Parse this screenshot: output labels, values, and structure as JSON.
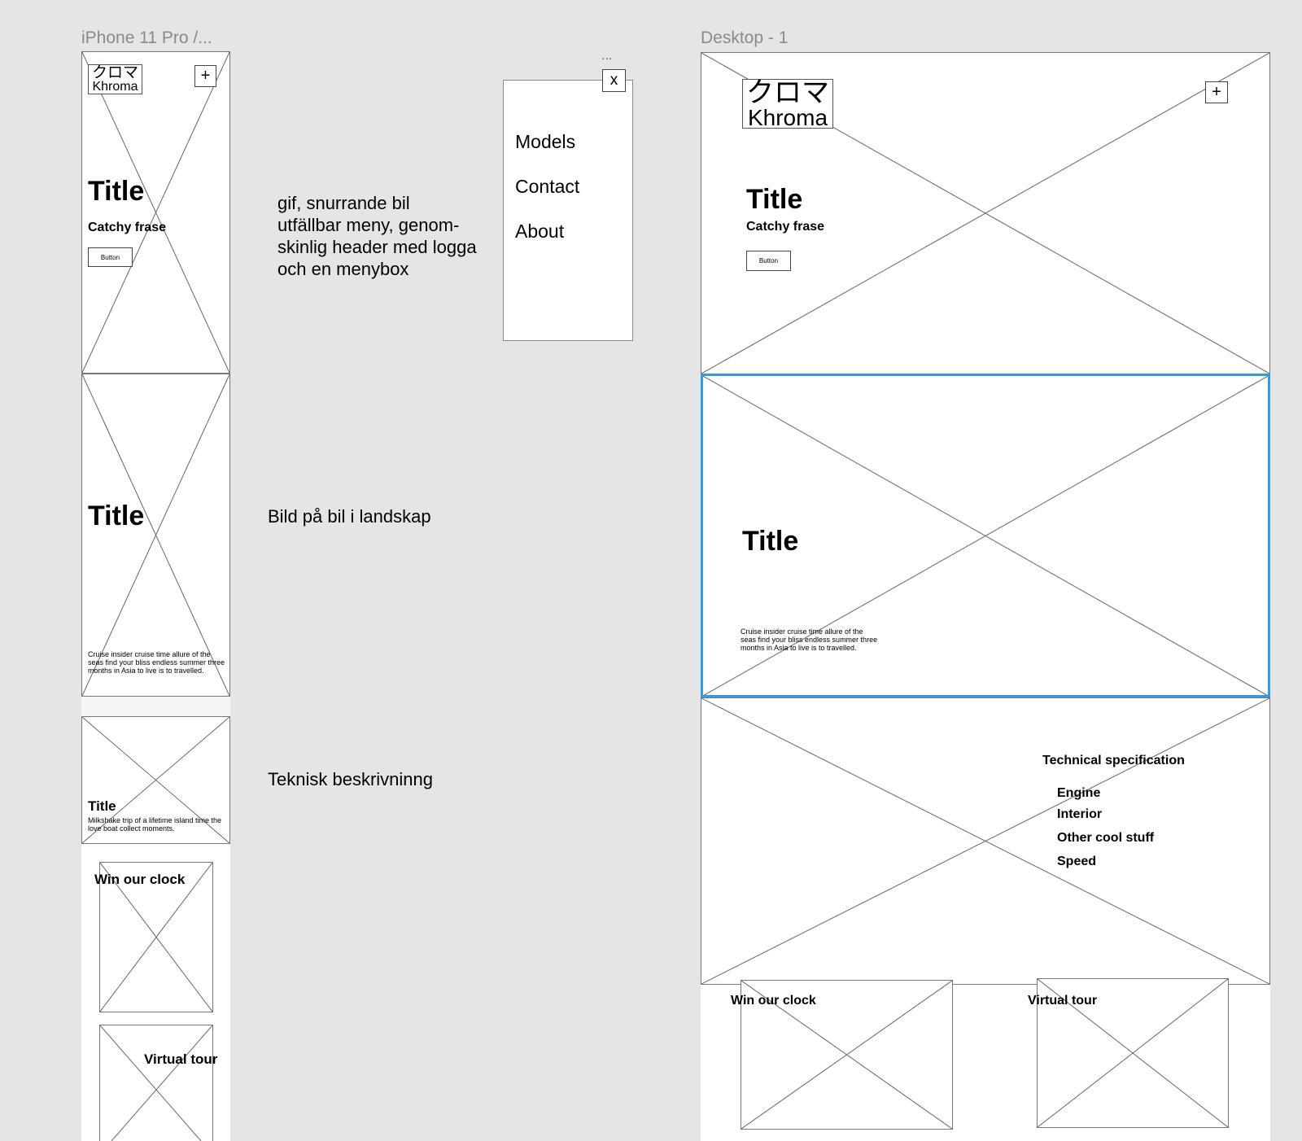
{
  "frames": {
    "iphone_label": "iPhone 11 Pro /...",
    "desktop_label": "Desktop - 1"
  },
  "logo": {
    "japanese": "クロマ",
    "latin": "Khroma"
  },
  "header": {
    "plus": "+"
  },
  "hero": {
    "title": "Title",
    "tagline": "Catchy frase",
    "button": "Button"
  },
  "landscape": {
    "title": "Title",
    "body": "Cruise insider cruise time allure of the seas find your bliss endless summer three months in Asia to live is to travelled."
  },
  "tech_mobile": {
    "title": "Title",
    "body": "Milkshake trip of a lifetime island time the love boat collect moments."
  },
  "tech_desktop": {
    "heading": "Technical specification",
    "items": [
      "Engine",
      "Interior",
      "Other cool stuff",
      "Speed"
    ]
  },
  "cards": {
    "clock": "Win our clock",
    "tour": "Virtual tour"
  },
  "menu": {
    "dots": "...",
    "close": "x",
    "items": [
      "Models",
      "Contact",
      "About"
    ]
  },
  "notes": {
    "hero": [
      "gif, snurrande bil",
      "utfällbar meny, genom-",
      "skinlig header med logga",
      "och en menybox"
    ],
    "landscape": "Bild på bil i landskap",
    "tech": "Teknisk beskrivninng"
  },
  "colors": {
    "canvas": "#e5e5e5",
    "selection": "#2d9bf0",
    "wire": "#666666"
  }
}
